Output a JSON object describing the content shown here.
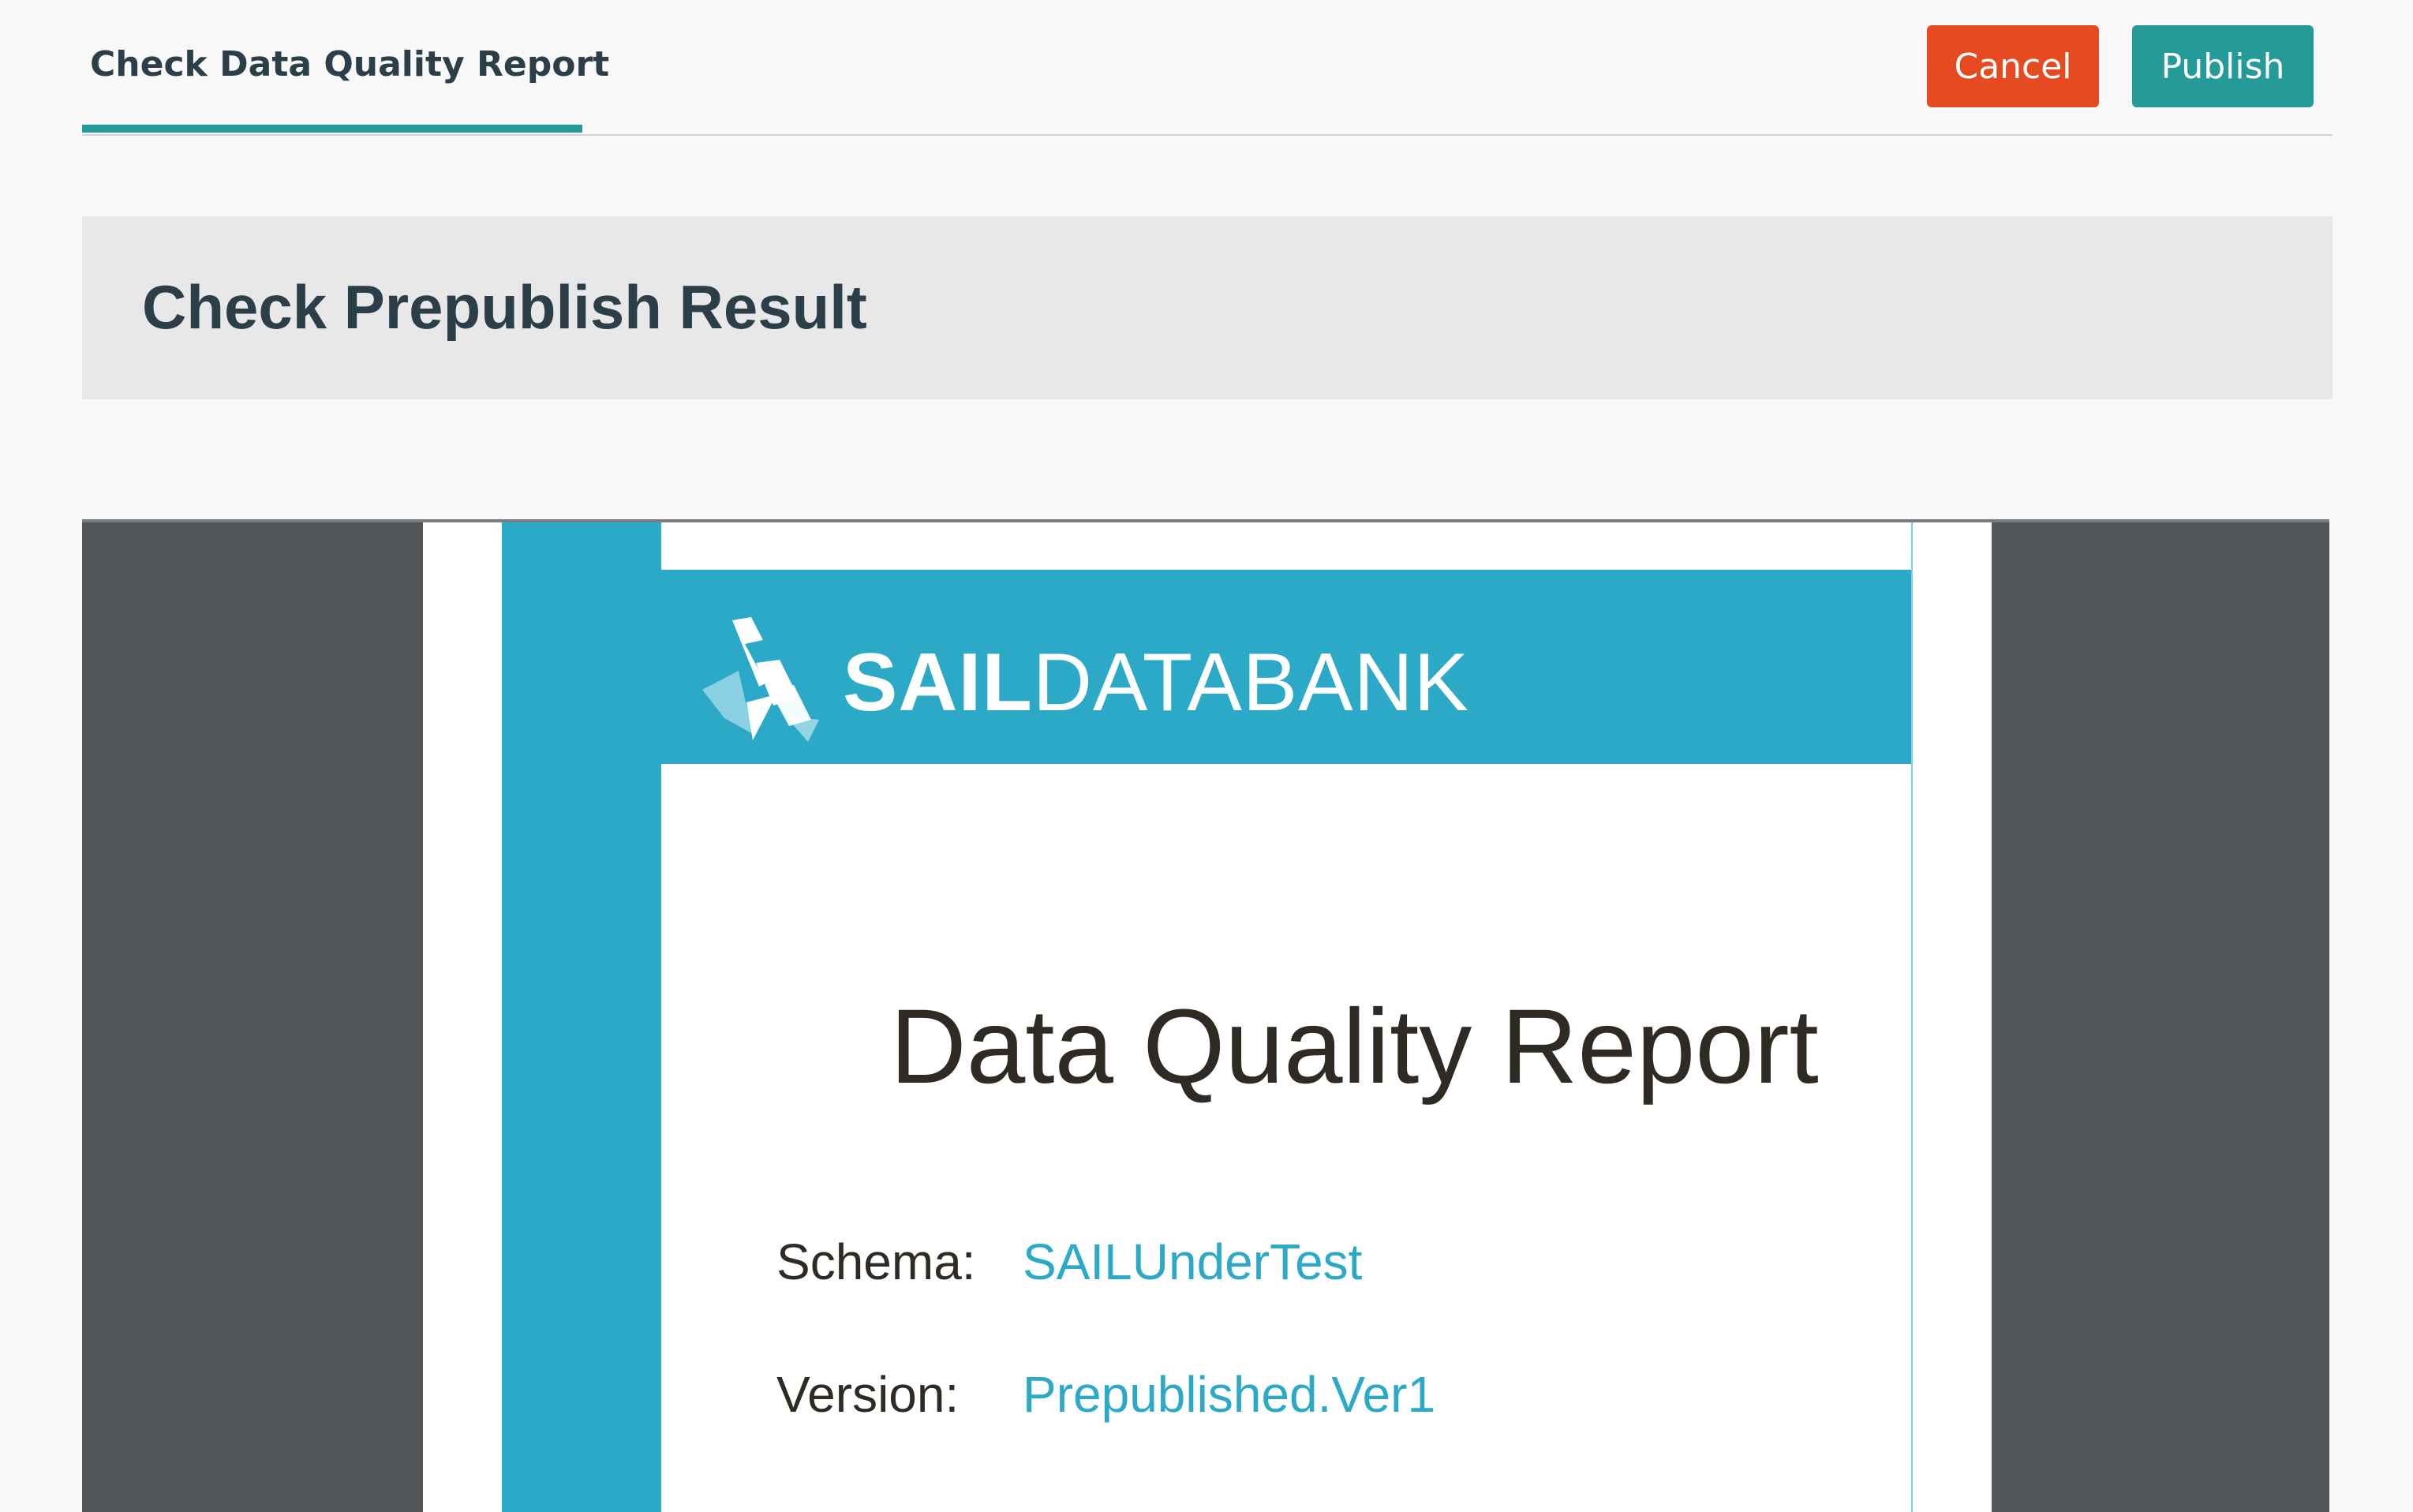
{
  "header": {
    "tab_label": "Check Data Quality Report",
    "cancel_label": "Cancel",
    "publish_label": "Publish"
  },
  "result": {
    "title": "Check Prepublish Result"
  },
  "report": {
    "logo_bold": "SAIL",
    "logo_light": "DATABANK",
    "title": "Data Quality Report",
    "schema_label": "Schema:",
    "schema_value": "SAILUnderTest",
    "version_label": "Version:",
    "version_value": "Prepublished.Ver1"
  },
  "colors": {
    "accent_teal": "#259b99",
    "cancel_red": "#e54a21",
    "report_blue": "#2ba9c6",
    "viewer_bg": "#53575a"
  }
}
